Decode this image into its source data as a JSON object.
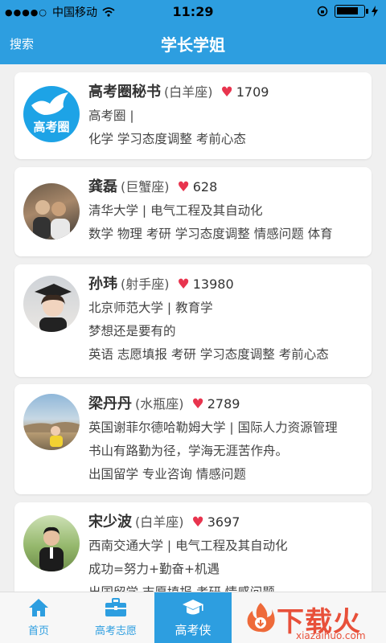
{
  "status_bar": {
    "carrier": "中国移动",
    "time": "11:29"
  },
  "nav": {
    "left_label": "搜索",
    "title": "学长学姐"
  },
  "cards": [
    {
      "name": "高考圈秘书",
      "sign": "(白羊座)",
      "likes": "1709",
      "line1": "高考圈 |",
      "line2": "化学 学习态度调整 考前心态",
      "line3": "",
      "avatar_text": "高考圈"
    },
    {
      "name": "龚磊",
      "sign": "(巨蟹座)",
      "likes": "628",
      "line1": "清华大学 | 电气工程及其自动化",
      "line2": "数学 物理 考研 学习态度调整 情感问题 体育",
      "line3": ""
    },
    {
      "name": "孙玮",
      "sign": "(射手座)",
      "likes": "13980",
      "line1": "北京师范大学 | 教育学",
      "line2": "梦想还是要有的",
      "line3": "英语 志愿填报 考研 学习态度调整 考前心态"
    },
    {
      "name": "梁丹丹",
      "sign": "(水瓶座)",
      "likes": "2789",
      "line1": "英国谢菲尔德哈勒姆大学 | 国际人力资源管理",
      "line2": "书山有路勤为径，学海无涯苦作舟。",
      "line3": "出国留学 专业咨询 情感问题"
    },
    {
      "name": "宋少波",
      "sign": "(白羊座)",
      "likes": "3697",
      "line1": "西南交通大学 | 电气工程及其自动化",
      "line2": "成功=努力+勤奋+机遇",
      "line3": "出国留学 志愿填报 考研 情感问题"
    }
  ],
  "tabs": [
    {
      "label": "首页",
      "icon": "home-icon"
    },
    {
      "label": "高考志愿",
      "icon": "briefcase-icon"
    },
    {
      "label": "高考侠",
      "icon": "graduation-cap-icon"
    }
  ],
  "watermark": {
    "text": "下载火",
    "url": "xiazaihuo.com"
  },
  "colors": {
    "primary": "#2d9ee0",
    "heart": "#e8344e"
  }
}
